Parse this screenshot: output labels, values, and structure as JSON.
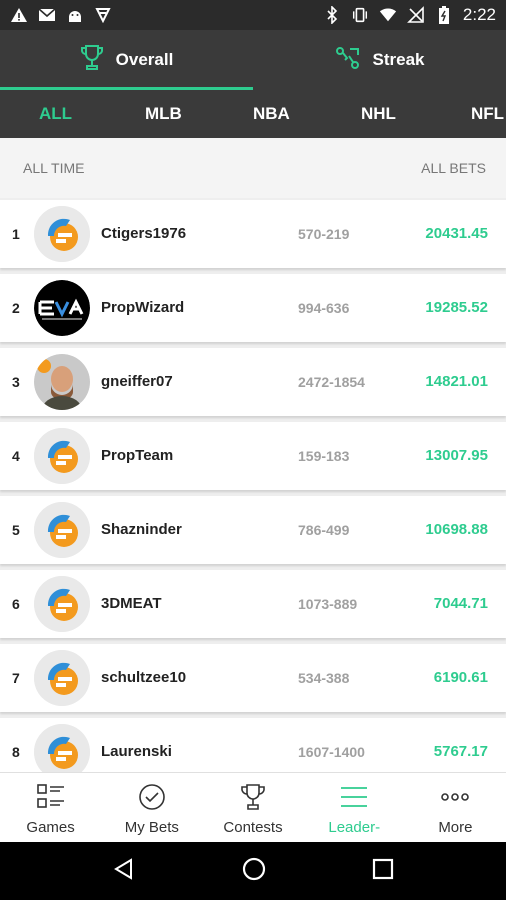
{
  "status_bar": {
    "time": "2:22"
  },
  "main_tabs": [
    {
      "label": "Overall",
      "icon": "trophy-icon",
      "active": true
    },
    {
      "label": "Streak",
      "icon": "streak-icon",
      "active": false
    }
  ],
  "sport_tabs": [
    {
      "label": "ALL",
      "active": true
    },
    {
      "label": "MLB",
      "active": false
    },
    {
      "label": "NBA",
      "active": false
    },
    {
      "label": "NHL",
      "active": false
    },
    {
      "label": "NFL",
      "active": false
    }
  ],
  "list_header": {
    "left": "ALL TIME",
    "right": "ALL BETS"
  },
  "leaders": [
    {
      "rank": "1",
      "name": "Ctigers1976",
      "record": "570-219",
      "amount": "20431.45",
      "avatar": "app-logo"
    },
    {
      "rank": "2",
      "name": "PropWizard",
      "record": "994-636",
      "amount": "19285.52",
      "avatar": "eva-logo"
    },
    {
      "rank": "3",
      "name": "gneiffer07",
      "record": "2472-1854",
      "amount": "14821.01",
      "avatar": "photo"
    },
    {
      "rank": "4",
      "name": "PropTeam",
      "record": "159-183",
      "amount": "13007.95",
      "avatar": "app-logo"
    },
    {
      "rank": "5",
      "name": "Shazninder",
      "record": "786-499",
      "amount": "10698.88",
      "avatar": "app-logo"
    },
    {
      "rank": "6",
      "name": "3DMEAT",
      "record": "1073-889",
      "amount": "7044.71",
      "avatar": "app-logo"
    },
    {
      "rank": "7",
      "name": "schultzee10",
      "record": "534-388",
      "amount": "6190.61",
      "avatar": "app-logo"
    },
    {
      "rank": "8",
      "name": "Laurenski",
      "record": "1607-1400",
      "amount": "5767.17",
      "avatar": "app-logo"
    }
  ],
  "bottom_nav": [
    {
      "label": "Games",
      "icon": "games-icon",
      "active": false
    },
    {
      "label": "My Bets",
      "icon": "check-circle-icon",
      "active": false
    },
    {
      "label": "Contests",
      "icon": "trophy-icon",
      "active": false
    },
    {
      "label": "Leader-",
      "icon": "list-icon",
      "active": true
    },
    {
      "label": "More",
      "icon": "more-dots-icon",
      "active": false
    }
  ],
  "colors": {
    "accent": "#2ecc8f",
    "header_bg": "#3a3a3a",
    "status_bg": "#2b2b2b"
  }
}
